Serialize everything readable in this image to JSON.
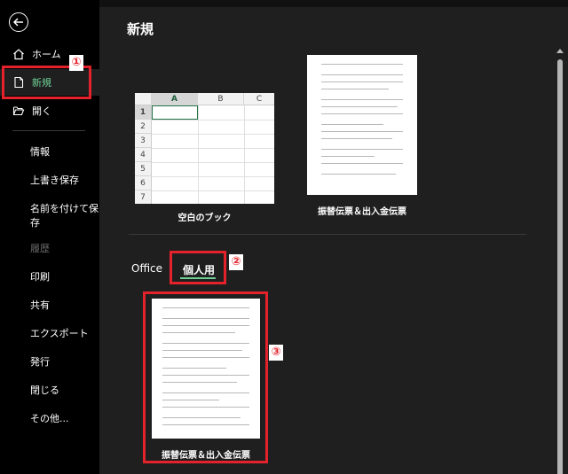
{
  "sidebar": {
    "items": [
      {
        "label": "ホーム",
        "icon": "home-icon"
      },
      {
        "label": "新規",
        "icon": "new-document-icon"
      },
      {
        "label": "開く",
        "icon": "open-folder-icon"
      }
    ],
    "sub_items": [
      "情報",
      "上書き保存",
      "名前を付けて保存",
      "履歴",
      "印刷",
      "共有",
      "エクスポート",
      "発行",
      "閉じる",
      "その他..."
    ]
  },
  "main": {
    "title": "新規",
    "featured_templates": [
      {
        "label": "空白のブック"
      },
      {
        "label": "振替伝票＆出入金伝票"
      }
    ],
    "tabs": [
      {
        "label": "Office"
      },
      {
        "label": "個人用"
      }
    ],
    "personal_templates": [
      {
        "label": "振替伝票＆出入金伝票"
      }
    ]
  },
  "grid": {
    "columns": [
      "A",
      "B",
      "C"
    ],
    "rows": [
      "1",
      "2",
      "3",
      "4",
      "5",
      "6",
      "7"
    ]
  },
  "annotations": {
    "badge1": "①",
    "badge2": "②",
    "badge3": "③"
  },
  "colors": {
    "accent": "#6fcf97",
    "highlight": "#e3222b",
    "sidebar_bg": "#000000",
    "main_bg": "#1f1f1f"
  }
}
